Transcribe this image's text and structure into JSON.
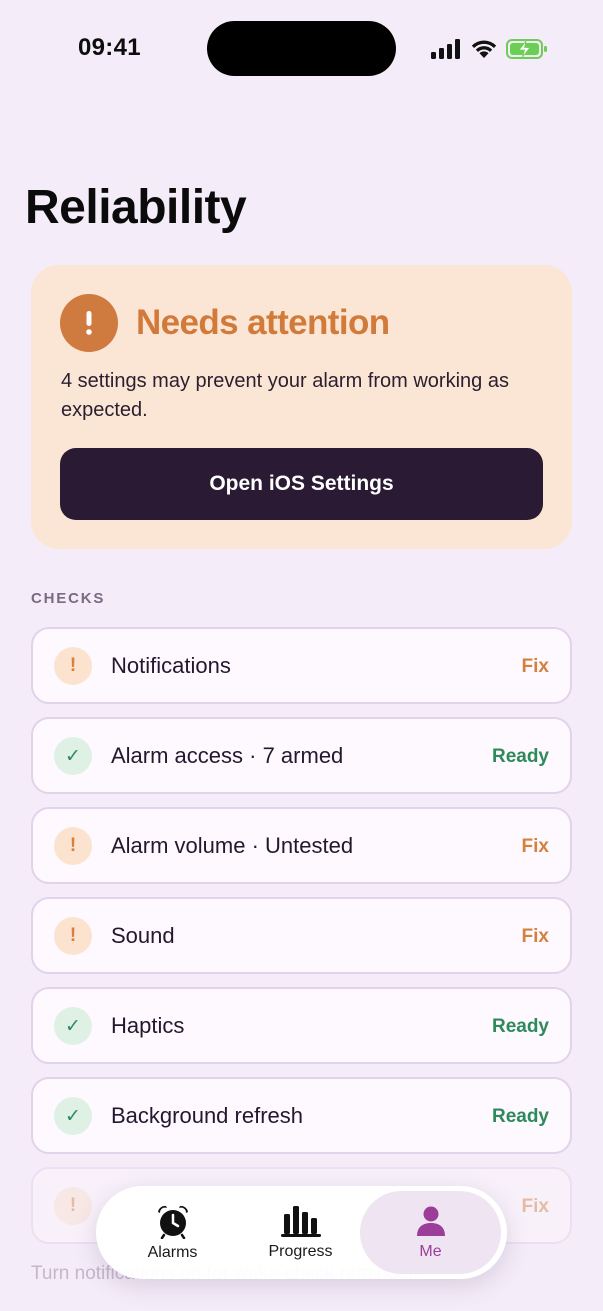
{
  "status_bar": {
    "time": "09:41"
  },
  "page": {
    "title": "Reliability"
  },
  "attention": {
    "icon": "exclamation-icon",
    "title": "Needs attention",
    "body": "4 settings may prevent your alarm from working as expected.",
    "button_label": "Open iOS Settings"
  },
  "checks": {
    "section_label": "CHECKS",
    "items": [
      {
        "label": "Notifications",
        "status": "Fix",
        "state": "warn",
        "icon_glyph": "!"
      },
      {
        "label": "Alarm access · 7 armed",
        "status": "Ready",
        "state": "ok",
        "icon_glyph": "✓"
      },
      {
        "label": "Alarm volume · Untested",
        "status": "Fix",
        "state": "warn",
        "icon_glyph": "!"
      },
      {
        "label": "Sound",
        "status": "Fix",
        "state": "warn",
        "icon_glyph": "!"
      },
      {
        "label": "Haptics",
        "status": "Ready",
        "state": "ok",
        "icon_glyph": "✓"
      },
      {
        "label": "Background refresh",
        "status": "Ready",
        "state": "ok",
        "icon_glyph": "✓"
      },
      {
        "label": "",
        "status": "Fix",
        "state": "warn",
        "icon_glyph": "!"
      }
    ]
  },
  "footer_hint": "Turn notifications on for wake-check reminders",
  "tab_bar": {
    "tabs": [
      {
        "label": "Alarms",
        "icon": "alarm-clock-icon"
      },
      {
        "label": "Progress",
        "icon": "bar-chart-icon"
      },
      {
        "label": "Me",
        "icon": "person-icon",
        "active": true
      }
    ]
  },
  "colors": {
    "background": "#f4ecf8",
    "attention_bg": "#fbe5d4",
    "warn": "#d27a3a",
    "ready": "#2f8a5b",
    "button_dark": "#2a1a33",
    "active_tab": "#9c3d9a"
  }
}
